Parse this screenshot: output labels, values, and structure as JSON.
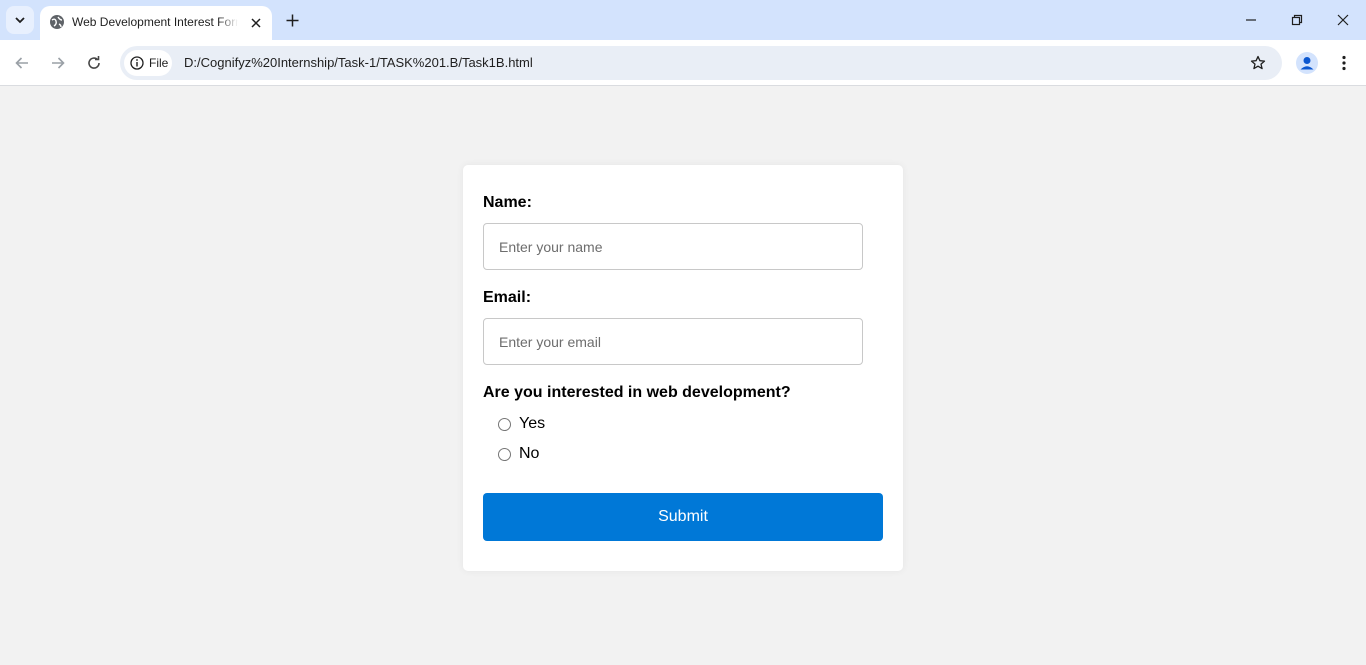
{
  "browser": {
    "tab_title": "Web Development Interest Form",
    "url_chip": "File",
    "url": "D:/Cognifyz%20Internship/Task-1/TASK%201.B/Task1B.html"
  },
  "form": {
    "name_label": "Name:",
    "name_placeholder": "Enter your name",
    "email_label": "Email:",
    "email_placeholder": "Enter your email",
    "question": "Are you interested in web development?",
    "options": [
      "Yes",
      "No"
    ],
    "submit_label": "Submit"
  },
  "colors": {
    "page_bg": "#f2f2f2",
    "tabstrip_bg": "#d3e3fd",
    "submit_bg": "#0078d7"
  },
  "icons": [
    "tab-search-icon",
    "globe-icon",
    "close-icon",
    "plus-icon",
    "minimize-icon",
    "restore-icon",
    "window-close-icon",
    "back-icon",
    "forward-icon",
    "reload-icon",
    "info-icon",
    "star-icon",
    "profile-icon",
    "menu-icon"
  ]
}
